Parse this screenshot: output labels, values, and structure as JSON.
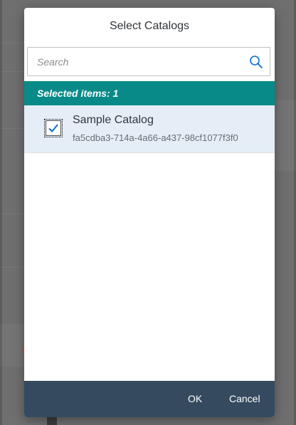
{
  "dialog": {
    "title": "Select Catalogs",
    "search": {
      "placeholder": "Search",
      "value": ""
    },
    "info_bar": "Selected items: 1",
    "items": [
      {
        "title": "Sample Catalog",
        "description": "fa5cdba3-714a-4a66-a437-98cf1077f3f0",
        "selected": true
      }
    ],
    "buttons": {
      "ok_label": "OK",
      "cancel_label": "Cancel"
    }
  },
  "colors": {
    "info_bar": "#078a88",
    "footer": "#354a5f",
    "selected_row": "#e5eef7",
    "accent": "#0a6ed1"
  },
  "icons": {
    "search": "search-icon",
    "checkbox": "checkmark-icon"
  }
}
